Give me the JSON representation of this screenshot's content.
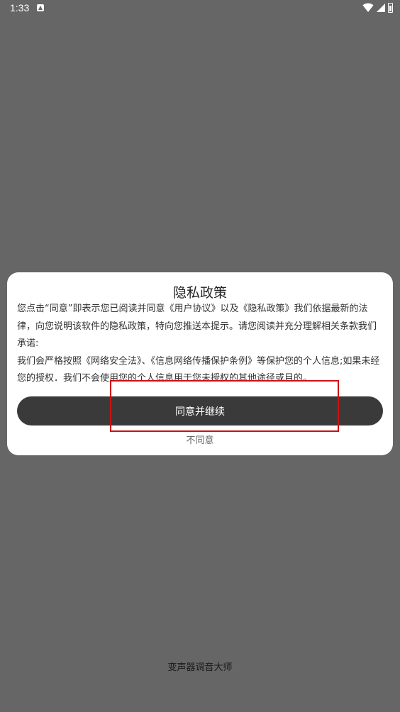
{
  "status_bar": {
    "time": "1:33",
    "icons": [
      "app-notification-icon",
      "wifi-icon",
      "signal-icon",
      "battery-icon"
    ]
  },
  "dialog": {
    "title": "隐私政策",
    "paragraph_1": "您点击“同意”即表示您已阅读并同意《用户协议》以及《隐私政策》我们依据最新的法律，向您说明该软件的隐私政策，特向您推送本提示。请您阅读并充分理解相关条款我们承诺:",
    "paragraph_2": "我们会严格按照《网络安全法》、《信息网络传播保护条例》等保护您的个人信息;如果未经您的授权．我们不会使用您的个人信息用于您未授权的其他途径或目的。",
    "agree_button_label": "同意并继续",
    "disagree_label": "不同意"
  },
  "footer": {
    "app_name": "变声器调音大师"
  },
  "colors": {
    "background": "#666666",
    "dialog": "#ffffff",
    "button": "#3a3a3a",
    "highlight": "#cc1111"
  }
}
